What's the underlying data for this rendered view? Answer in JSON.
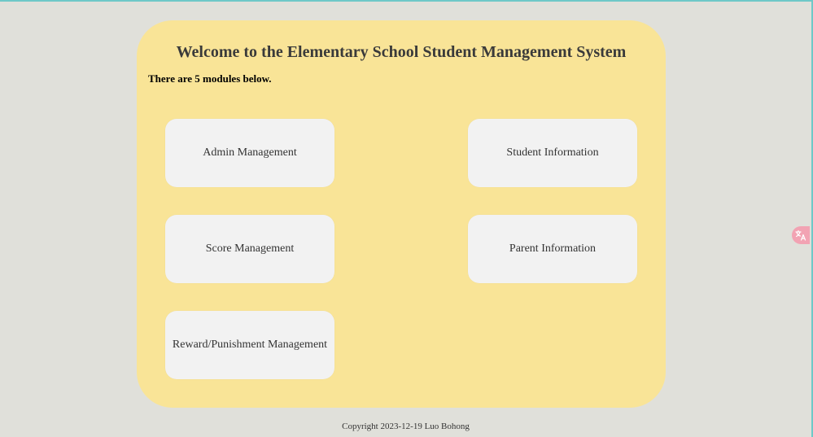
{
  "header": {
    "title": "Welcome to the Elementary School Student Management System",
    "subtitle": "There are 5 modules below."
  },
  "modules": [
    {
      "label": "Admin Management"
    },
    {
      "label": "Student Information"
    },
    {
      "label": "Score Management"
    },
    {
      "label": "Parent Information"
    },
    {
      "label": "Reward/Punishment Management"
    }
  ],
  "footer": {
    "copyright": "Copyright 2023-12-19 Luo Bohong"
  },
  "colors": {
    "page_background": "#e0e0da",
    "panel_background": "#f9e497",
    "card_background": "#f2f2f2",
    "translate_button": "#f2a3b3"
  },
  "icons": {
    "translate": "translate-icon"
  }
}
